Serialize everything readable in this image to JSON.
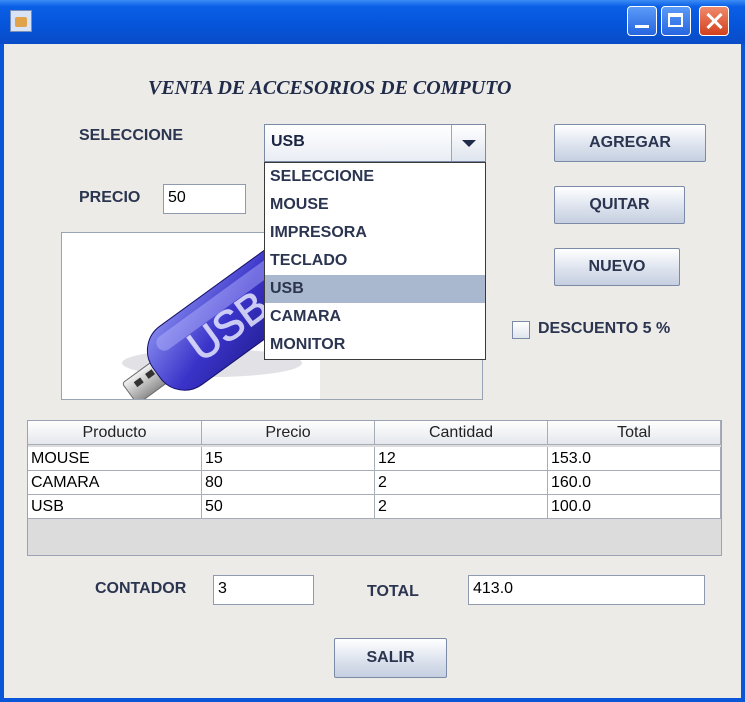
{
  "window": {
    "controls": [
      "minimize",
      "maximize",
      "close"
    ]
  },
  "heading": "VENTA DE ACCESORIOS DE COMPUTO",
  "labels": {
    "seleccione": "SELECCIONE",
    "precio": "PRECIO",
    "contador": "CONTADOR",
    "total": "TOTAL"
  },
  "combo": {
    "selected": "USB",
    "options": [
      "SELECCIONE",
      "MOUSE",
      "IMPRESORA",
      "TECLADO",
      "USB",
      "CAMARA",
      "MONITOR"
    ],
    "highlighted_index": 4
  },
  "fields": {
    "precio": "50",
    "contador": "3",
    "total": "413.0"
  },
  "buttons": {
    "agregar": "AGREGAR",
    "quitar": "QUITAR",
    "nuevo": "NUEVO",
    "salir": "SALIR"
  },
  "checkbox": {
    "label": "DESCUENTO 5 %",
    "checked": false
  },
  "image": {
    "text": "USB",
    "icon": "usb-flash-drive-icon"
  },
  "table": {
    "columns": [
      "Producto",
      "Precio",
      "Cantidad",
      "Total"
    ],
    "rows": [
      [
        "MOUSE",
        "15",
        "12",
        "153.0"
      ],
      [
        "CAMARA",
        "80",
        "2",
        "160.0"
      ],
      [
        "USB",
        "50",
        "2",
        "100.0"
      ]
    ]
  },
  "colors": {
    "titlebar": "#0554d9",
    "panel": "#ecebe8",
    "selection": "#aab8cf"
  }
}
